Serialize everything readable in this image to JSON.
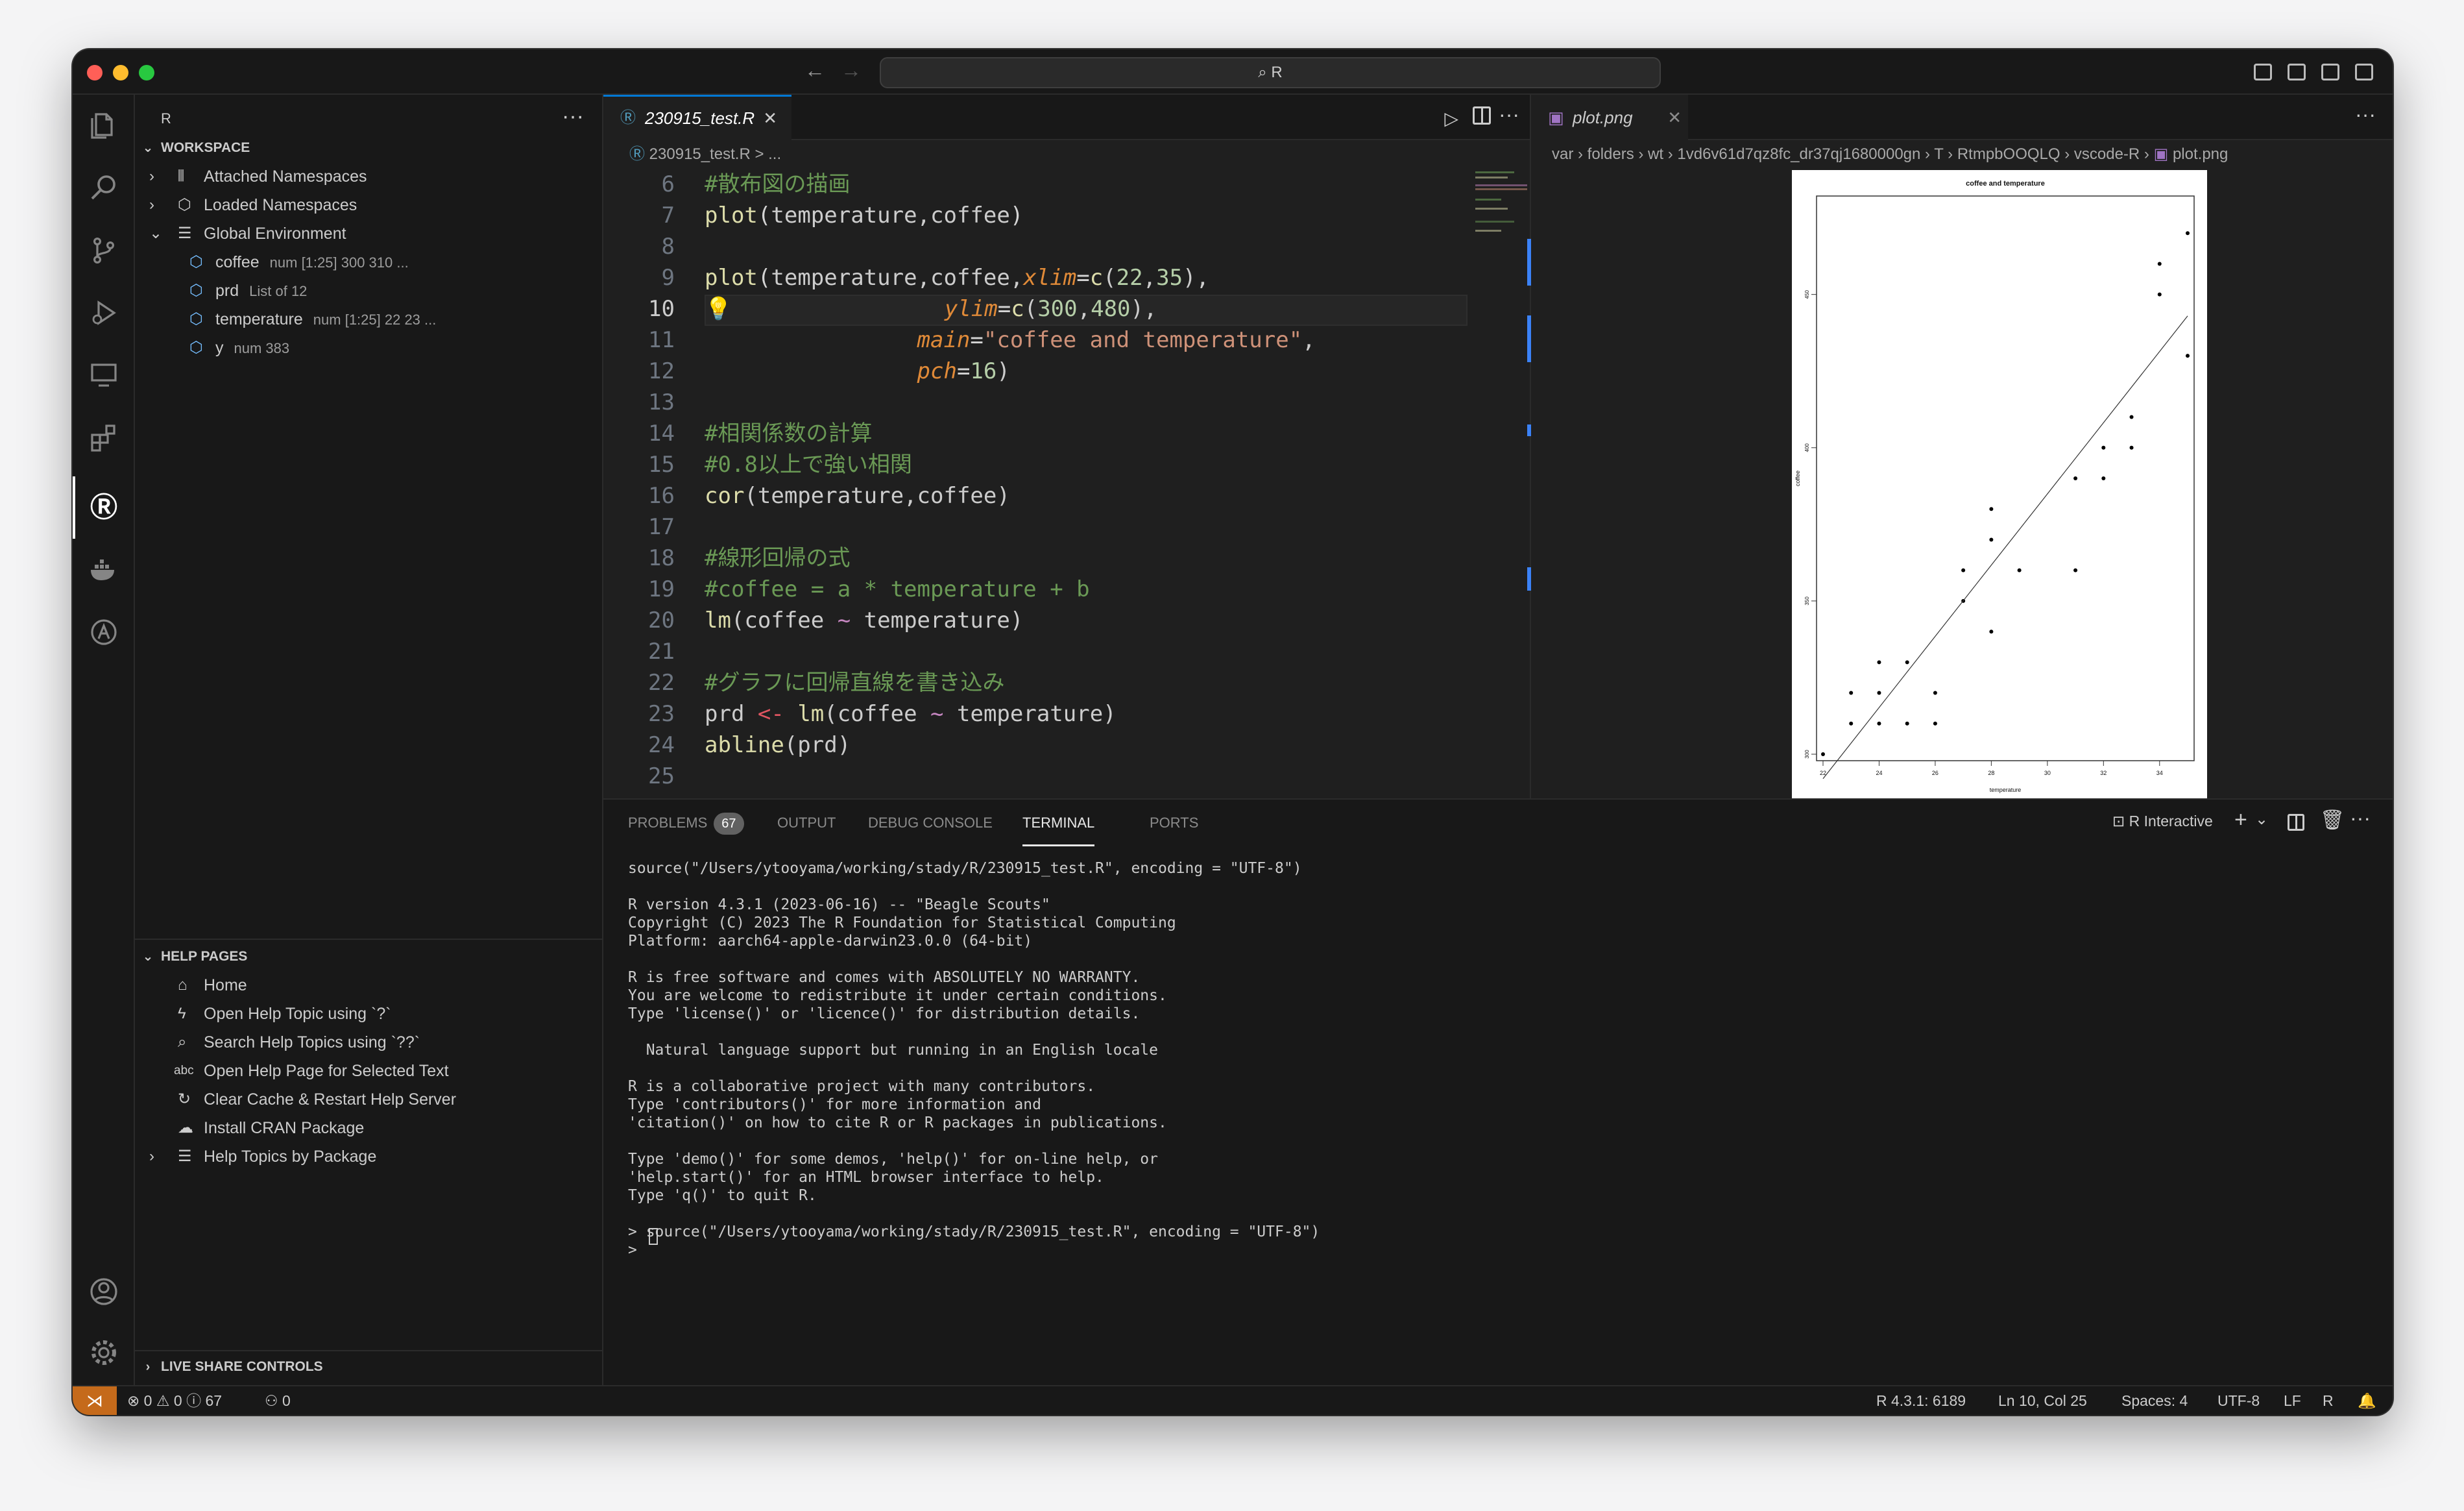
{
  "window": {
    "search_text": "R",
    "traffic_lights": [
      "#ff5f57",
      "#febc2e",
      "#28c840"
    ]
  },
  "sidebar": {
    "header": "R",
    "workspace_title": "WORKSPACE",
    "workspace_items": [
      {
        "label": "Attached Namespaces"
      },
      {
        "label": "Loaded Namespaces"
      },
      {
        "label": "Global Environment"
      }
    ],
    "env_items": [
      {
        "label": "coffee",
        "desc": "num [1:25] 300 310 ..."
      },
      {
        "label": "prd",
        "desc": "List of 12"
      },
      {
        "label": "temperature",
        "desc": "num [1:25] 22 23 ..."
      },
      {
        "label": "y",
        "desc": "num 383"
      }
    ],
    "help_title": "HELP PAGES",
    "help_items": [
      {
        "label": "Home"
      },
      {
        "label": "Open Help Topic using `?`"
      },
      {
        "label": "Search Help Topics using `??`"
      },
      {
        "label": "Open Help Page for Selected Text"
      },
      {
        "label": "Clear Cache & Restart Help Server"
      },
      {
        "label": "Install CRAN Package"
      },
      {
        "label": "Help Topics by Package"
      }
    ],
    "live_share_title": "LIVE SHARE CONTROLS"
  },
  "editor": {
    "tab_label": "230915_test.R",
    "breadcrumb": "230915_test.R > ...",
    "line_numbers": [
      "6",
      "7",
      "8",
      "9",
      "10",
      "11",
      "12",
      "13",
      "14",
      "15",
      "16",
      "17",
      "18",
      "19",
      "20",
      "21",
      "22",
      "23",
      "24",
      "25"
    ],
    "current_line": "10"
  },
  "image_viewer": {
    "tab_label": "plot.png",
    "breadcrumb": [
      "var",
      "folders",
      "wt",
      "1vd6v61d7qz8fc_dr37qj1680000gn",
      "T",
      "RtmpbOOQLQ",
      "vscode-R",
      "plot.png"
    ]
  },
  "plot": {
    "title": "coffee and temperature",
    "xlabel": "temperature",
    "ylabel": "coffee",
    "x_ticks": [
      "22",
      "24",
      "26",
      "28",
      "30",
      "32",
      "34"
    ],
    "y_ticks": [
      "300",
      "350",
      "400",
      "450"
    ]
  },
  "chart_data": {
    "type": "scatter",
    "title": "coffee and temperature",
    "xlabel": "temperature",
    "ylabel": "coffee",
    "xlim": [
      22,
      35
    ],
    "ylim": [
      300,
      480
    ],
    "points": [
      [
        22,
        300
      ],
      [
        23,
        310
      ],
      [
        23,
        320
      ],
      [
        24,
        310
      ],
      [
        24,
        320
      ],
      [
        24,
        330
      ],
      [
        25,
        310
      ],
      [
        25,
        330
      ],
      [
        26,
        310
      ],
      [
        26,
        320
      ],
      [
        27,
        350
      ],
      [
        27,
        360
      ],
      [
        28,
        340
      ],
      [
        28,
        370
      ],
      [
        28,
        380
      ],
      [
        29,
        360
      ],
      [
        31,
        360
      ],
      [
        31,
        390
      ],
      [
        32,
        390
      ],
      [
        32,
        400
      ],
      [
        33,
        400
      ],
      [
        33,
        410
      ],
      [
        34,
        450
      ],
      [
        34,
        460
      ],
      [
        35,
        430
      ],
      [
        35,
        470
      ]
    ],
    "regression_line": {
      "x": [
        22,
        35
      ],
      "y": [
        292,
        443
      ]
    }
  },
  "panel": {
    "tabs": [
      {
        "label": "PROBLEMS"
      },
      {
        "label": "OUTPUT"
      },
      {
        "label": "DEBUG CONSOLE"
      },
      {
        "label": "TERMINAL"
      },
      {
        "label": "PORTS"
      }
    ],
    "problems_count": "67",
    "terminal_name": "R Interactive",
    "terminal_text": "source(\"/Users/ytooyama/working/stady/R/230915_test.R\", encoding = \"UTF-8\")\n\nR version 4.3.1 (2023-06-16) -- \"Beagle Scouts\"\nCopyright (C) 2023 The R Foundation for Statistical Computing\nPlatform: aarch64-apple-darwin23.0.0 (64-bit)\n\nR is free software and comes with ABSOLUTELY NO WARRANTY.\nYou are welcome to redistribute it under certain conditions.\nType 'license()' or 'licence()' for distribution details.\n\n  Natural language support but running in an English locale\n\nR is a collaborative project with many contributors.\nType 'contributors()' for more information and\n'citation()' on how to cite R or R packages in publications.\n\nType 'demo()' for some demos, 'help()' for on-line help, or\n'help.start()' for an HTML browser interface to help.\nType 'q()' to quit R.\n\n> source(\"/Users/ytooyama/working/stady/R/230915_test.R\", encoding = \"UTF-8\")\n> "
  },
  "statusbar": {
    "errors": "0",
    "warnings": "0",
    "info": "67",
    "ports": "0",
    "r_version": "R 4.3.1: 6189",
    "cursor": "Ln 10, Col 25",
    "spaces": "Spaces: 4",
    "encoding": "UTF-8",
    "eol": "LF",
    "language": "R"
  }
}
